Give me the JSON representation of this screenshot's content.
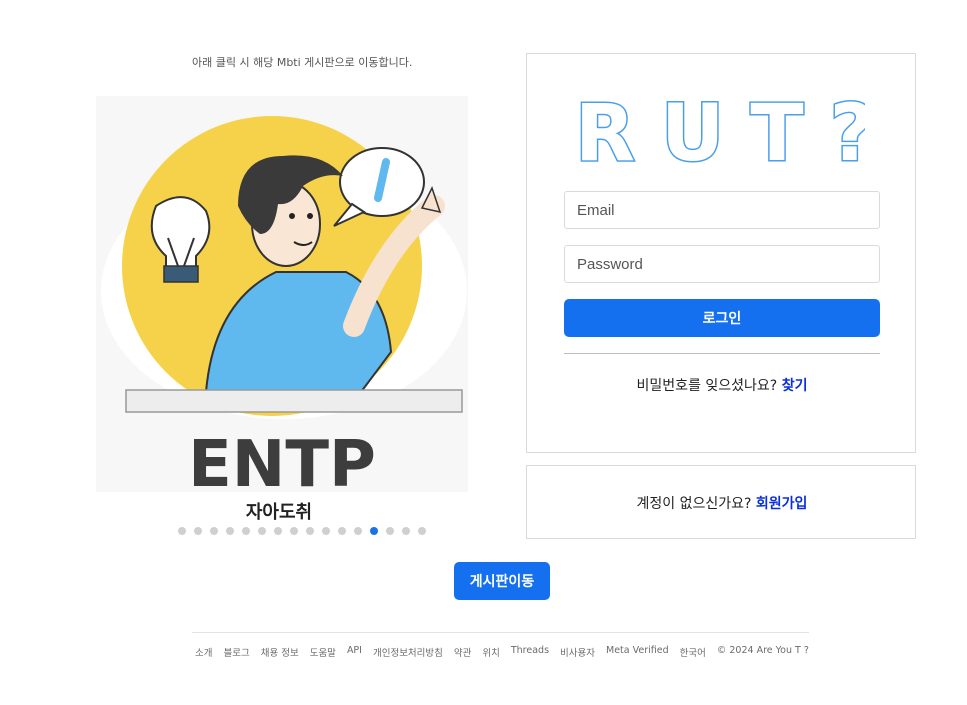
{
  "hint_text": "아래 클릭 시 해당 Mbti 게시판으로 이동합니다.",
  "carousel": {
    "mbti": "ENTP",
    "caption": "자아도취",
    "dot_count": 16,
    "active_index": 12
  },
  "login": {
    "logo_text": "RUT?",
    "email_placeholder": "Email",
    "password_placeholder": "Password",
    "login_label": "로그인",
    "forgot_text": "비밀번호를 잊으셨나요?",
    "forgot_link": "찾기"
  },
  "signup": {
    "text": "계정이 없으신가요?",
    "link": "회원가입"
  },
  "board_button": "게시판이동",
  "footer": {
    "links": [
      "소개",
      "블로그",
      "채용 정보",
      "도움말",
      "API",
      "개인정보처리방침",
      "약관",
      "위치",
      "Threads",
      "비사용자",
      "Meta Verified",
      "한국어"
    ],
    "copyright": "© 2024 Are You T ?"
  },
  "colors": {
    "accent": "#1570ef",
    "link": "#0a2ee0",
    "logo_blue": "#4a9fea",
    "illustration_yellow": "#f6d24a",
    "shirt_blue": "#5fb8ee"
  }
}
